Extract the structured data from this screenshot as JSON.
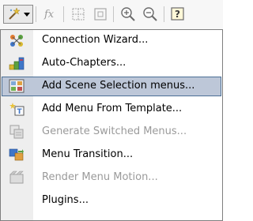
{
  "toolbar": {
    "buttons": [
      {
        "icon": "wand-icon",
        "state": "pressed"
      },
      {
        "icon": "dropdown-arrow-icon"
      },
      {
        "icon": "function-icon",
        "state": "disabled"
      },
      {
        "icon": "grid-icon",
        "state": "disabled"
      },
      {
        "icon": "frame-icon",
        "state": "disabled"
      },
      {
        "icon": "zoom-in-icon"
      },
      {
        "icon": "zoom-out-icon"
      },
      {
        "icon": "help-icon"
      }
    ]
  },
  "menu": {
    "highlight_color": "#bdc7d8",
    "disabled_color": "#9a9a9a",
    "items": [
      {
        "label": "Connection Wizard...",
        "icon": "connection-wizard-icon",
        "enabled": true
      },
      {
        "label": "Auto-Chapters...",
        "icon": "auto-chapters-icon",
        "enabled": true
      },
      {
        "label": "Add Scene Selection menus...",
        "icon": "scene-selection-icon",
        "enabled": true,
        "highlighted": true
      },
      {
        "label": "Add Menu From Template...",
        "icon": "menu-template-icon",
        "enabled": true
      },
      {
        "label": "Generate Switched Menus...",
        "icon": "switched-menus-icon",
        "enabled": false
      },
      {
        "label": "Menu Transition...",
        "icon": "menu-transition-icon",
        "enabled": true
      },
      {
        "label": "Render Menu Motion...",
        "icon": "render-motion-icon",
        "enabled": false
      },
      {
        "label": "Plugins...",
        "icon": "plugins-icon",
        "enabled": true
      }
    ]
  }
}
